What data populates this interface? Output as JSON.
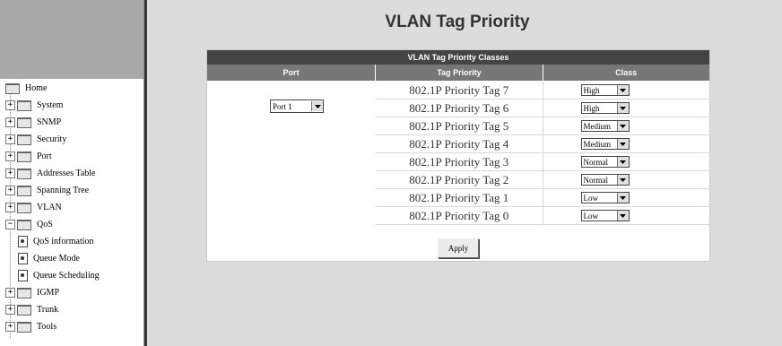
{
  "page_title": "VLAN Tag Priority",
  "table": {
    "title": "VLAN Tag Priority Classes",
    "headers": {
      "port": "Port",
      "tag": "Tag Priority",
      "class": "Class"
    },
    "port_value": "Port 1",
    "rows": [
      {
        "tag": "802.1P Priority Tag 7",
        "class": "High"
      },
      {
        "tag": "802.1P Priority Tag 6",
        "class": "High"
      },
      {
        "tag": "802.1P Priority Tag 5",
        "class": "Medium"
      },
      {
        "tag": "802.1P Priority Tag 4",
        "class": "Medium"
      },
      {
        "tag": "802.1P Priority Tag 3",
        "class": "Normal"
      },
      {
        "tag": "802.1P Priority Tag 2",
        "class": "Normal"
      },
      {
        "tag": "802.1P Priority Tag 1",
        "class": "Low"
      },
      {
        "tag": "802.1P Priority Tag 0",
        "class": "Low"
      }
    ]
  },
  "apply_label": "Apply",
  "sidebar": {
    "items": [
      {
        "label": "Home",
        "icon": "folder-icon"
      },
      {
        "label": "System",
        "icon": "folder-icon"
      },
      {
        "label": "SNMP",
        "icon": "folder-icon"
      },
      {
        "label": "Security",
        "icon": "folder-icon"
      },
      {
        "label": "Port",
        "icon": "folder-icon"
      },
      {
        "label": "Addresses Table",
        "icon": "folder-icon"
      },
      {
        "label": "Spanning Tree",
        "icon": "folder-icon"
      },
      {
        "label": "VLAN",
        "icon": "folder-icon"
      },
      {
        "label": "QoS",
        "icon": "folder-icon"
      },
      {
        "label": "QoS information",
        "icon": "page-icon"
      },
      {
        "label": "Queue Mode",
        "icon": "page-icon"
      },
      {
        "label": "Queue Scheduling",
        "icon": "page-icon"
      },
      {
        "label": "IGMP",
        "icon": "folder-icon"
      },
      {
        "label": "Trunk",
        "icon": "folder-icon"
      },
      {
        "label": "Tools",
        "icon": "folder-icon"
      }
    ]
  },
  "colors": {
    "title_bar": "#444444",
    "header_bar": "#777777",
    "page_bg": "#dcdcdc",
    "banner": "#a9a9a9"
  }
}
